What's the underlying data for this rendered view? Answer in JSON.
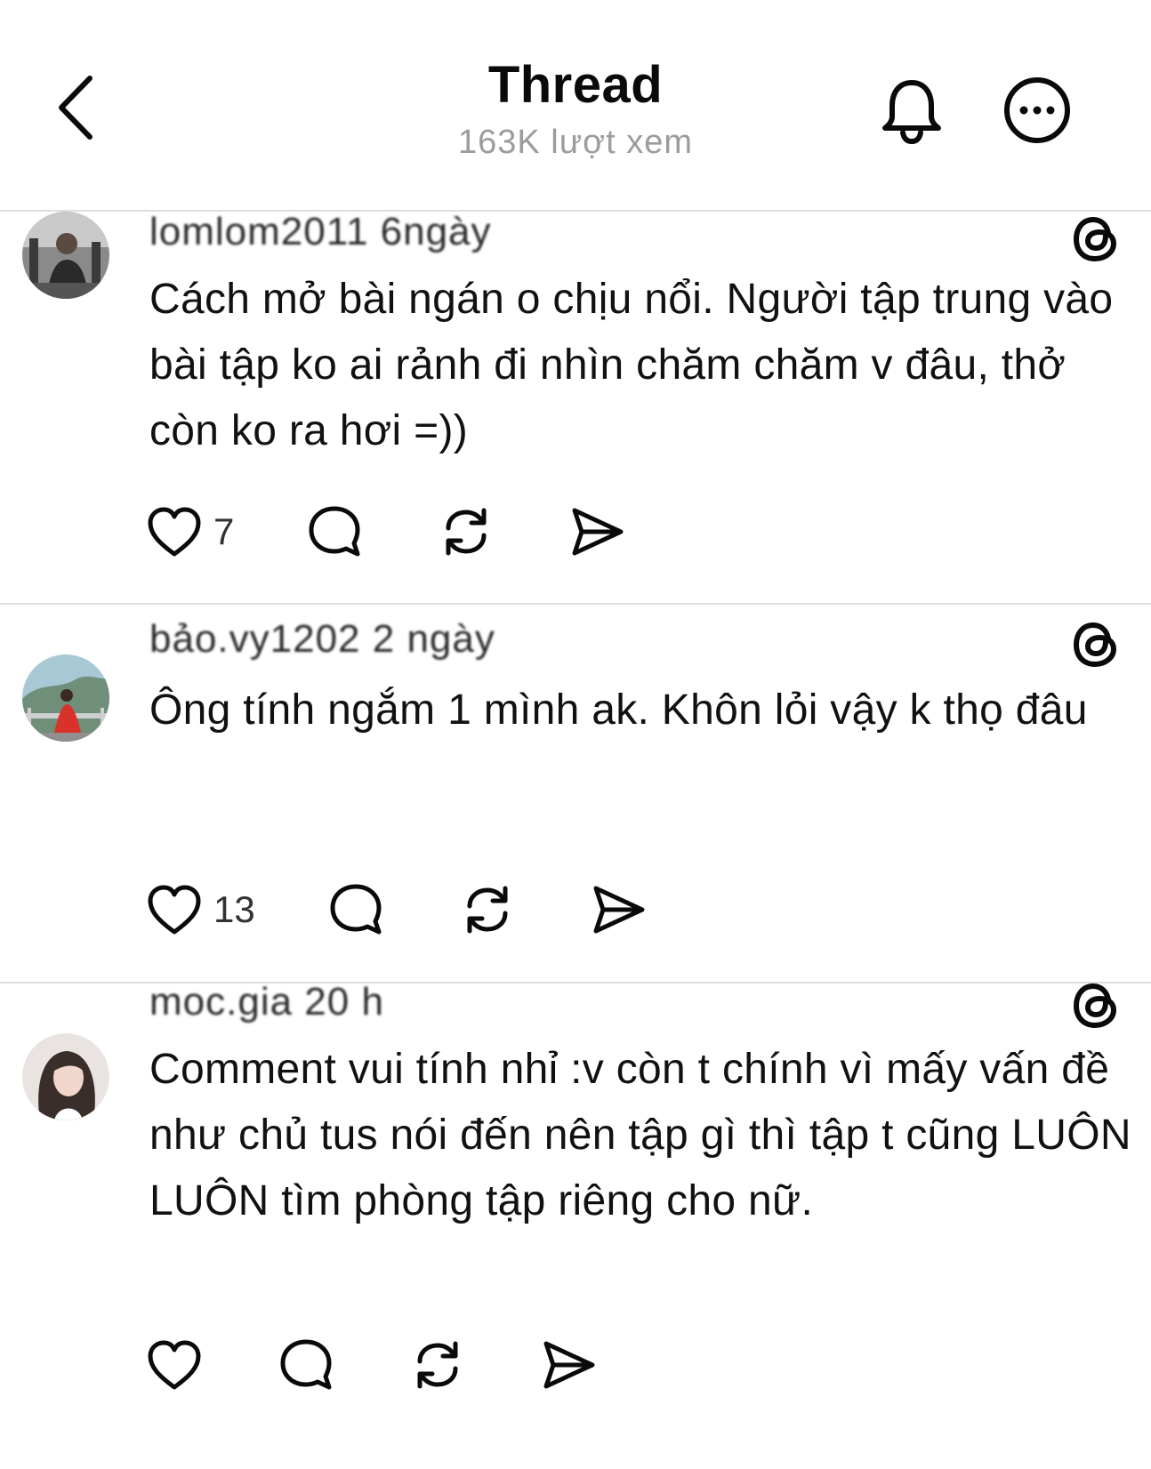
{
  "header": {
    "title": "Thread",
    "views": "163K lượt xem",
    "icons": [
      "back-chevron-icon",
      "bell-icon",
      "more-options-icon"
    ]
  },
  "window_dot_colors": [
    "#e06b5f",
    "#e5b73b",
    "#5fc15a"
  ],
  "posts": [
    {
      "username": "lomlom2011 6ngày",
      "text": "Cách mở bài ngán o chịu nổi. Người tập trung vào bài tập ko ai rảnh đi nhìn chăm chăm v đâu, thở còn ko ra hơi =))",
      "likes": "7"
    },
    {
      "username": "bảo.vy1202 2 ngày",
      "text": "Ông tính ngắm 1 mình ak. Khôn lỏi vậy k thọ đâu",
      "likes": "13"
    },
    {
      "username": "moc.gia 20 h",
      "text": "Comment vui tính nhỉ :v còn t chính vì mấy vấn đề như chủ tus nói đến nên tập gì thì tập t cũng LUÔN LUÔN tìm phòng tập riêng cho nữ.",
      "likes": ""
    }
  ],
  "colors": {
    "divider": "#dedede",
    "muted_text": "#9c9c9c",
    "icon": "#0a0a0a"
  }
}
